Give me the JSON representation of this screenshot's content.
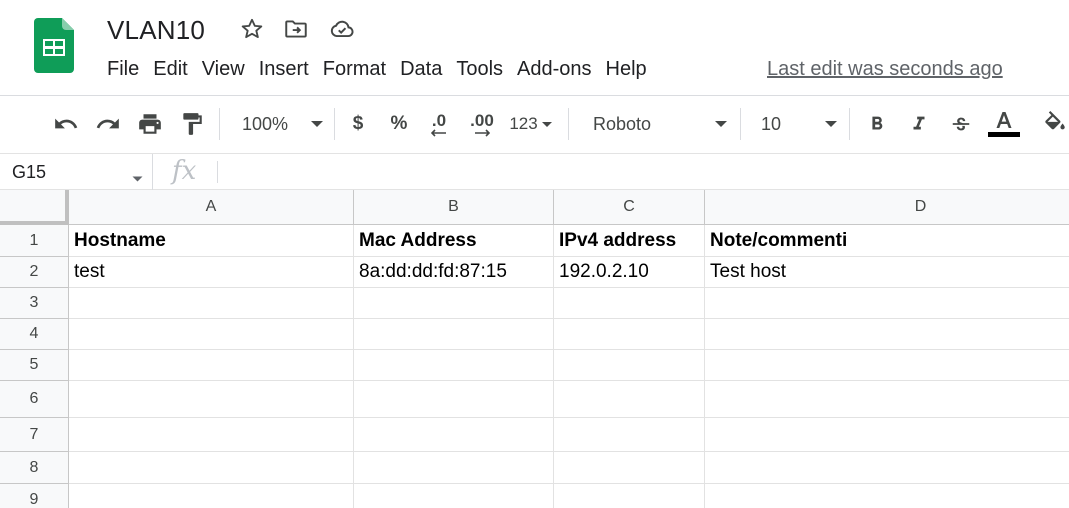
{
  "document": {
    "title": "VLAN10",
    "last_edit": "Last edit was seconds ago",
    "title_icons": [
      "star-icon",
      "move-to-folder-icon",
      "cloud-saved-icon"
    ]
  },
  "menu": {
    "items": [
      "File",
      "Edit",
      "View",
      "Insert",
      "Format",
      "Data",
      "Tools",
      "Add-ons",
      "Help"
    ]
  },
  "toolbar": {
    "zoom": "100%",
    "currency": "$",
    "percent": "%",
    "decrease_decimal": ".0",
    "increase_decimal": ".00",
    "more_formats": "123",
    "font": "Roboto",
    "font_size": "10"
  },
  "formula_bar": {
    "cell_reference": "G15",
    "fx_symbol": "fx",
    "value": ""
  },
  "sheet": {
    "columns": [
      "A",
      "B",
      "C",
      "D"
    ],
    "rows": [
      "1",
      "2",
      "3",
      "4",
      "5",
      "6",
      "7",
      "8",
      "9"
    ],
    "cells": {
      "A1": "Hostname",
      "B1": "Mac Address",
      "C1": "IPv4 address",
      "D1": "Note/commenti",
      "A2": "test",
      "B2": "8a:dd:dd:fd:87:15",
      "C2": "192.0.2.10",
      "D2": "Test host"
    }
  },
  "colors": {
    "brand_green": "#0f9d58",
    "header_bg": "#f8f9fa",
    "gridline": "#e2e2e2"
  }
}
